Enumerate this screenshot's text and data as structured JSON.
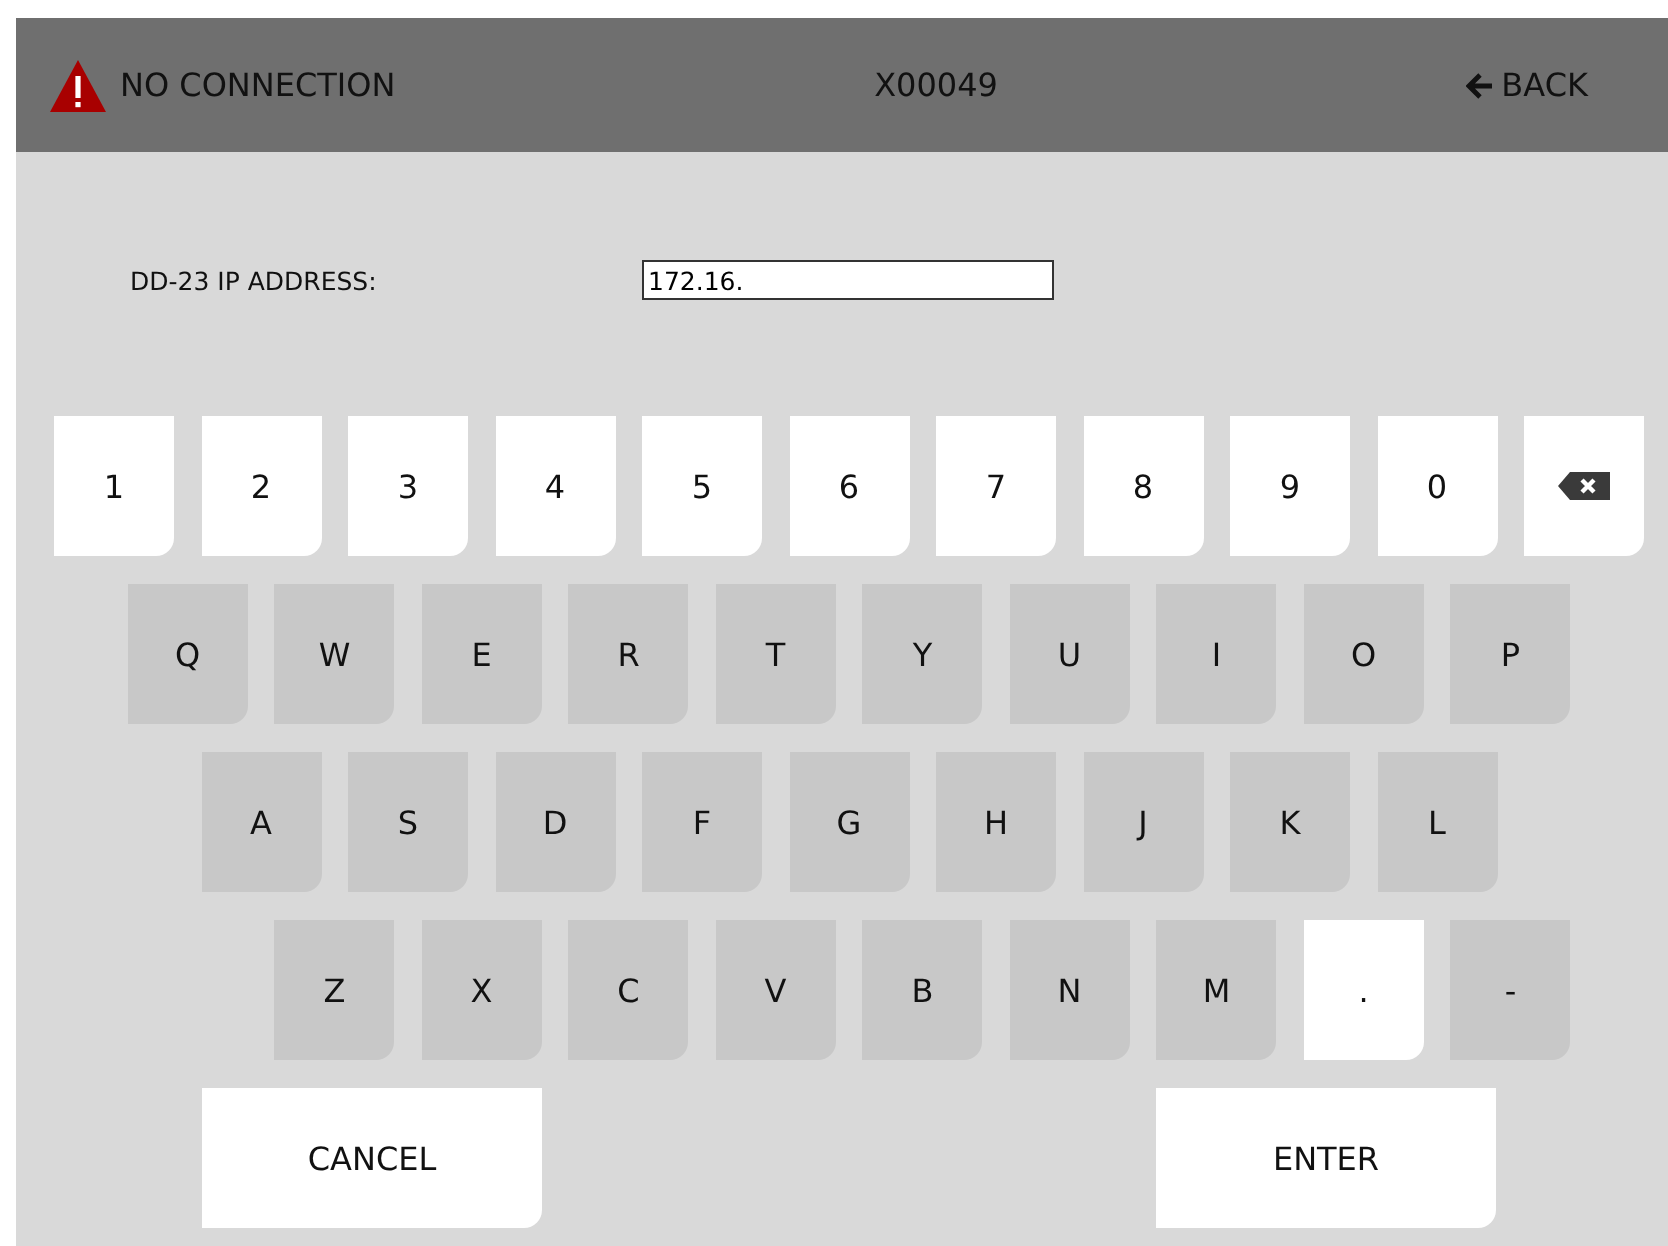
{
  "header": {
    "status": "NO CONNECTION",
    "device_id": "X00049",
    "back": "BACK"
  },
  "form": {
    "label": "DD-23 IP ADDRESS:",
    "value": "172.16."
  },
  "keyboard": [
    [
      {
        "kind": "char",
        "label": "1",
        "disabled": false
      },
      {
        "kind": "char",
        "label": "2",
        "disabled": false
      },
      {
        "kind": "char",
        "label": "3",
        "disabled": false
      },
      {
        "kind": "char",
        "label": "4",
        "disabled": false
      },
      {
        "kind": "char",
        "label": "5",
        "disabled": false
      },
      {
        "kind": "char",
        "label": "6",
        "disabled": false
      },
      {
        "kind": "char",
        "label": "7",
        "disabled": false
      },
      {
        "kind": "char",
        "label": "8",
        "disabled": false
      },
      {
        "kind": "char",
        "label": "9",
        "disabled": false
      },
      {
        "kind": "char",
        "label": "0",
        "disabled": false
      },
      {
        "kind": "backspace",
        "disabled": false
      }
    ],
    [
      {
        "kind": "char",
        "label": "Q",
        "disabled": true
      },
      {
        "kind": "char",
        "label": "W",
        "disabled": true
      },
      {
        "kind": "char",
        "label": "E",
        "disabled": true
      },
      {
        "kind": "char",
        "label": "R",
        "disabled": true
      },
      {
        "kind": "char",
        "label": "T",
        "disabled": true
      },
      {
        "kind": "char",
        "label": "Y",
        "disabled": true
      },
      {
        "kind": "char",
        "label": "U",
        "disabled": true
      },
      {
        "kind": "char",
        "label": "I",
        "disabled": true
      },
      {
        "kind": "char",
        "label": "O",
        "disabled": true
      },
      {
        "kind": "char",
        "label": "P",
        "disabled": true
      }
    ],
    [
      {
        "kind": "char",
        "label": "A",
        "disabled": true
      },
      {
        "kind": "char",
        "label": "S",
        "disabled": true
      },
      {
        "kind": "char",
        "label": "D",
        "disabled": true
      },
      {
        "kind": "char",
        "label": "F",
        "disabled": true
      },
      {
        "kind": "char",
        "label": "G",
        "disabled": true
      },
      {
        "kind": "char",
        "label": "H",
        "disabled": true
      },
      {
        "kind": "char",
        "label": "J",
        "disabled": true
      },
      {
        "kind": "char",
        "label": "K",
        "disabled": true
      },
      {
        "kind": "char",
        "label": "L",
        "disabled": true
      }
    ],
    [
      {
        "kind": "char",
        "label": "Z",
        "disabled": true
      },
      {
        "kind": "char",
        "label": "X",
        "disabled": true
      },
      {
        "kind": "char",
        "label": "C",
        "disabled": true
      },
      {
        "kind": "char",
        "label": "V",
        "disabled": true
      },
      {
        "kind": "char",
        "label": "B",
        "disabled": true
      },
      {
        "kind": "char",
        "label": "N",
        "disabled": true
      },
      {
        "kind": "char",
        "label": "M",
        "disabled": true
      },
      {
        "kind": "char",
        "label": ".",
        "disabled": false
      },
      {
        "kind": "char",
        "label": "-",
        "disabled": true
      }
    ]
  ],
  "actions": [
    {
      "label": "CANCEL"
    },
    {
      "label": "ENTER"
    }
  ]
}
